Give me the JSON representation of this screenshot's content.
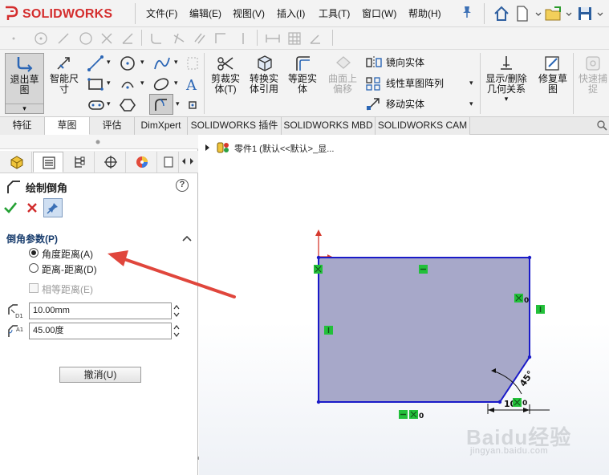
{
  "app": {
    "logo_text": "SOLIDWORKS"
  },
  "menu": {
    "items": [
      "文件(F)",
      "编辑(E)",
      "视图(V)",
      "插入(I)",
      "工具(T)",
      "窗口(W)",
      "帮助(H)"
    ]
  },
  "toolbar": {
    "exit_sketch": "退出草\n图",
    "smart_dim": "智能尺\n寸",
    "trim": "剪裁实\n体(T)",
    "convert": "转换实\n体引用",
    "offset": "等距实\n体",
    "surface_offset": "曲面上\n偏移",
    "mirror": "镜向实体",
    "pattern": "线性草图阵列",
    "move": "移动实体",
    "relations": "显示/删除\n几何关系",
    "repair": "修复草\n图",
    "quick_snap": "快速捕\n捉"
  },
  "tabs": [
    "特征",
    "草图",
    "评估",
    "DimXpert",
    "SOLIDWORKS 插件",
    "SOLIDWORKS MBD",
    "SOLIDWORKS CAM"
  ],
  "active_tab": "草图",
  "property_manager": {
    "title": "绘制倒角",
    "help": "?",
    "section": "倒角参数(P)",
    "options": [
      {
        "label": "角度距离(A)",
        "selected": true
      },
      {
        "label": "距离-距离(D)",
        "selected": false
      }
    ],
    "equal_distance": "相等距离(E)",
    "distance_value": "10.00mm",
    "angle_value": "45.00度",
    "d1_label": "D1",
    "a1_label": "A1",
    "undo_label": "撤消(U)"
  },
  "feature_tree": {
    "item": "零件1 (默认<<默认>_显..."
  },
  "sketch": {
    "dim_distance": "10",
    "dim_angle": "45°",
    "relation_zero": "0"
  },
  "watermark": {
    "brand": "Baidu经验",
    "url": "jingyan.baidu.com"
  },
  "colors": {
    "sketch_fill": "#a7a8c9",
    "sketch_line": "#1a1ac8",
    "relation_green": "#22c03a",
    "arrow_red": "#e0463c",
    "logo_red": "#d42d2d"
  }
}
